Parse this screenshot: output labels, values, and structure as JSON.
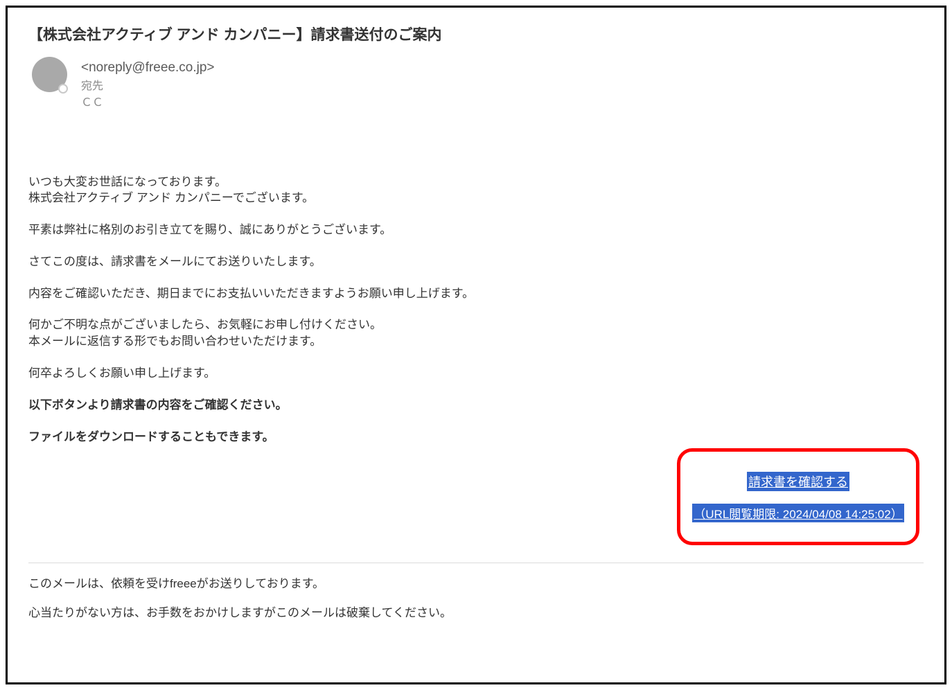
{
  "email": {
    "subject": "【株式会社アクティブ アンド カンパニー】請求書送付のご案内",
    "from_address": "<noreply@freee.co.jp>",
    "to_label": "宛先",
    "cc_label": "ＣＣ",
    "body": {
      "greeting_line1": "いつも大変お世話になっております。",
      "greeting_line2": "株式会社アクティブ アンド カンパニーでございます。",
      "thanks": "平素は弊社に格別のお引き立てを賜り、誠にありがとうございます。",
      "invoice_line": "さてこの度は、請求書をメールにてお送りいたします。",
      "payment_line": "内容をご確認いただき、期日までにお支払いいただきますようお願い申し上げます。",
      "inquiry_line1": "何かご不明な点がございましたら、お気軽にお申し付けください。",
      "inquiry_line2": "本メールに返信する形でもお問い合わせいただけます。",
      "closing": "何卒よろしくお願い申し上げます。",
      "bold_instruction1": "以下ボタンより請求書の内容をご確認ください。",
      "bold_instruction2": "ファイルをダウンロードすることもできます。"
    },
    "cta": {
      "button_label": "請求書を確認する",
      "expiry_label": "（URL閲覧期限: 2024/04/08 14:25:02）"
    },
    "footer": {
      "line1": "このメールは、依頼を受けfreeeがお送りしております。",
      "line2": "心当たりがない方は、お手数をおかけしますがこのメールは破棄してください。"
    }
  }
}
